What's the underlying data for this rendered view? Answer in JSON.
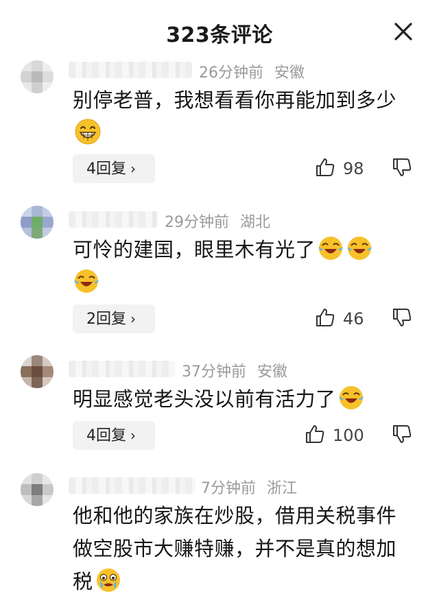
{
  "header": {
    "title": "323条评论"
  },
  "comments": [
    {
      "time": "26分钟前",
      "region": "安徽",
      "text": "别停老普，我想看看你再能加到多少",
      "emojis": [
        "grin-emoji"
      ],
      "reply_label": "4回复",
      "likes": "98"
    },
    {
      "time": "29分钟前",
      "region": "湖北",
      "text": "可怜的建国，眼里木有光了",
      "emojis": [
        "laugh-cry-emoji",
        "laugh-cry-emoji",
        "laugh-cry-emoji"
      ],
      "reply_label": "2回复",
      "likes": "46"
    },
    {
      "time": "37分钟前",
      "region": "安徽",
      "text": "明显感觉老头没以前有活力了",
      "emojis": [
        "laugh-cry-emoji"
      ],
      "reply_label": "4回复",
      "likes": "100"
    },
    {
      "time": "7分钟前",
      "region": "浙江",
      "text": "他和他的家族在炒股，借用关税事件做空股市大赚特赚，并不是真的想加税",
      "emojis": [
        "teary-emoji"
      ]
    }
  ]
}
